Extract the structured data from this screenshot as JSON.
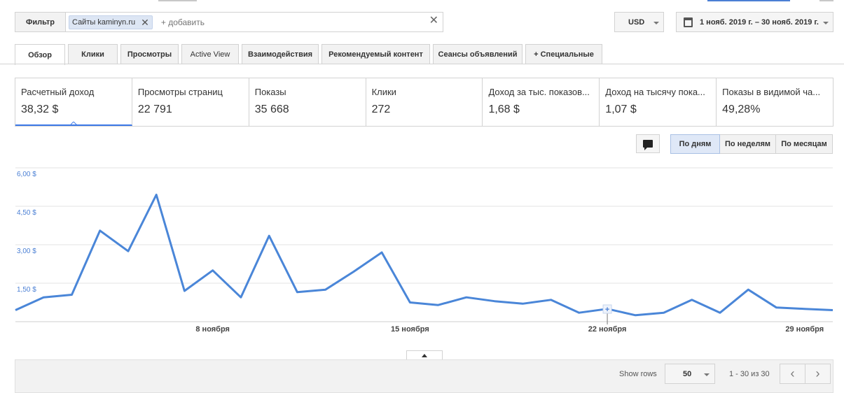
{
  "filter": {
    "label": "Фильтр",
    "chip_label": "Сайты kaminyn.ru",
    "add_placeholder": "+ добавить"
  },
  "currency": {
    "value": "USD"
  },
  "date_range": {
    "value": "1 нояб. 2019 г. – 30 нояб. 2019 г."
  },
  "tabs": [
    {
      "label": "Обзор"
    },
    {
      "label": "Клики"
    },
    {
      "label": "Просмотры"
    },
    {
      "label": "Active View"
    },
    {
      "label": "Взаимодействия"
    },
    {
      "label": "Рекомендуемый контент"
    },
    {
      "label": "Сеансы объявлений"
    },
    {
      "label": "+  Специальные"
    }
  ],
  "metrics": [
    {
      "label": "Расчетный доход",
      "value": "38,32 $"
    },
    {
      "label": "Просмотры страниц",
      "value": "22 791"
    },
    {
      "label": "Показы",
      "value": "35 668"
    },
    {
      "label": "Клики",
      "value": "272"
    },
    {
      "label": "Доход за тыс. показов...",
      "value": "1,68 $"
    },
    {
      "label": "Доход на тысячу пока...",
      "value": "1,07 $"
    },
    {
      "label": "Показы в видимой ча...",
      "value": "49,28%"
    }
  ],
  "period_buttons": [
    {
      "label": "По дням"
    },
    {
      "label": "По неделям"
    },
    {
      "label": "По месяцам"
    }
  ],
  "chart_data": {
    "type": "line",
    "x": [
      1,
      2,
      3,
      4,
      5,
      6,
      7,
      8,
      9,
      10,
      11,
      12,
      13,
      14,
      15,
      16,
      17,
      18,
      19,
      20,
      21,
      22,
      23,
      24,
      25,
      26,
      27,
      28,
      29,
      30
    ],
    "series": [
      {
        "values": [
          0.45,
          0.95,
          1.05,
          3.55,
          2.75,
          4.95,
          1.2,
          2.0,
          0.95,
          3.35,
          1.15,
          1.25,
          1.95,
          2.7,
          0.75,
          0.65,
          0.95,
          0.8,
          0.7,
          0.85,
          0.35,
          0.5,
          0.25,
          0.35,
          0.85,
          0.35,
          1.25,
          0.55,
          0.5,
          0.45
        ]
      }
    ],
    "y_ticks": [
      "1,50 $",
      "3,00 $",
      "4,50 $",
      "6,00 $"
    ],
    "y_tick_values": [
      1.5,
      3.0,
      4.5,
      6.0
    ],
    "ylim": [
      0,
      6
    ],
    "xlim": [
      1,
      30
    ],
    "x_ticks": [
      {
        "day": 8,
        "label": "8 ноября"
      },
      {
        "day": 15,
        "label": "15 ноября"
      },
      {
        "day": 22,
        "label": "22 ноября"
      },
      {
        "day": 29,
        "label": "29 ноября"
      }
    ],
    "grid": true,
    "color": "#4a86d8"
  },
  "table": {
    "show_rows_label": "Show rows",
    "rows_value": "50",
    "range_text": "1 - 30 из 30"
  }
}
